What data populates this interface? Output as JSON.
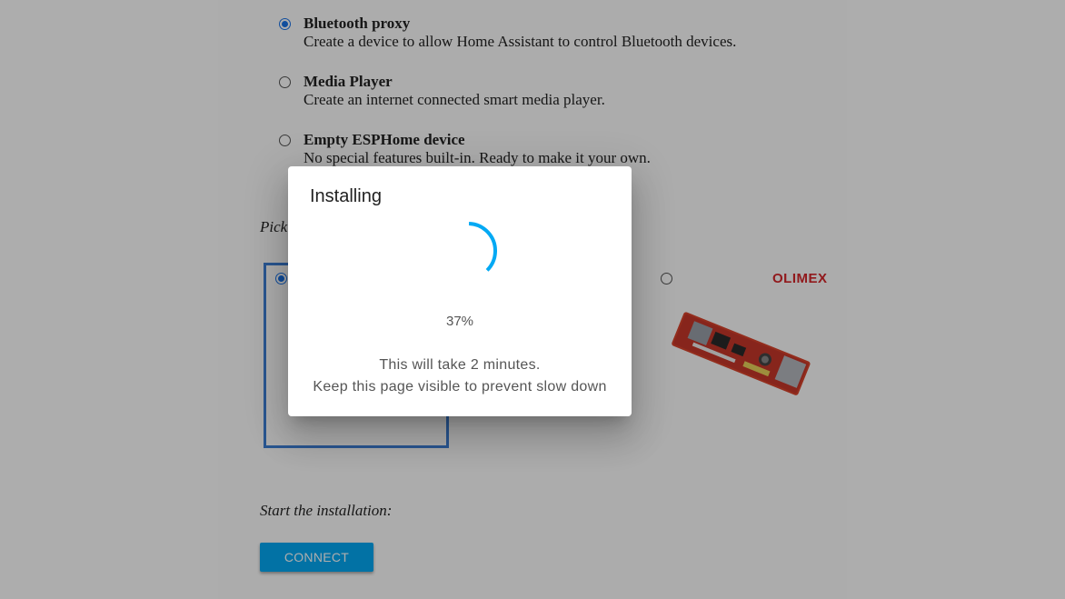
{
  "options": [
    {
      "title": "Bluetooth proxy",
      "description": "Create a device to allow Home Assistant to control Bluetooth devices.",
      "selected": true
    },
    {
      "title": "Media Player",
      "description": "Create an internet connected smart media player.",
      "selected": false
    },
    {
      "title": "Empty ESPHome device",
      "description": "No special features built-in. Ready to make it your own.",
      "selected": false
    }
  ],
  "board_section_label": "Pick",
  "board_logo": "OLIMEX",
  "install_section_label": "Start the installation:",
  "connect_button": "CONNECT",
  "dialog": {
    "title": "Installing",
    "progress_text": "37%",
    "progress_fraction": 0.37,
    "message_line1": "This will take 2 minutes.",
    "message_line2": "Keep this page visible to prevent slow down"
  },
  "colors": {
    "accent": "#03a9f4",
    "selection": "#1a73e8",
    "spinner": "#03a9f4"
  },
  "icons": {
    "spinner": "progress-spinner-icon",
    "board": "olimex-board-image"
  }
}
